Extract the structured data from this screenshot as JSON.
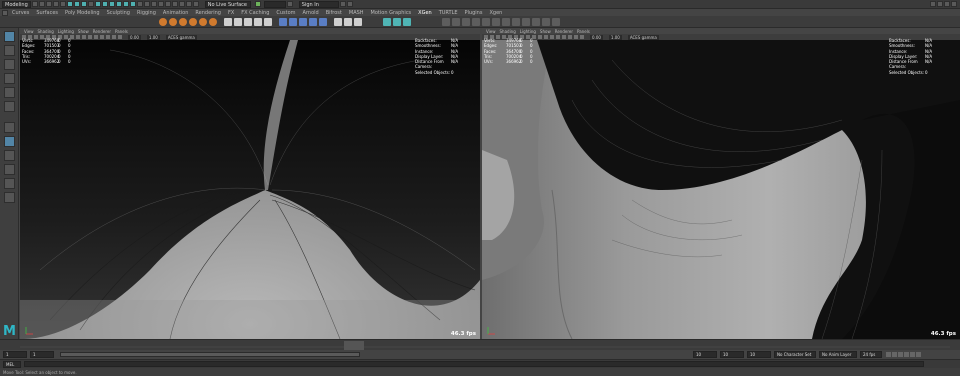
{
  "topbar": {
    "workspace": "Modeling",
    "surface_mode": "No Live Surface",
    "signin": "Sign In"
  },
  "shelf_tabs": [
    "Curves",
    "Surfaces",
    "Poly Modeling",
    "Sculpting",
    "Rigging",
    "Animation",
    "Rendering",
    "FX",
    "FX Caching",
    "Custom",
    "Arnold",
    "Bifrost",
    "MASH",
    "Motion Graphics",
    "XGen",
    "TURTLE",
    "Plugins",
    "Xgen"
  ],
  "shelf_active": "XGen",
  "viewport_menu": [
    "View",
    "Shading",
    "Lighting",
    "Show",
    "Renderer",
    "Panels"
  ],
  "left_viewport": {
    "camera_field": "0.00",
    "gamma_field": "1.00",
    "colorspace": "ACES gamma",
    "hud": [
      {
        "k": "Verts:",
        "v": "349768",
        "a": "0",
        "b": "0"
      },
      {
        "k": "Edges:",
        "v": "701503",
        "a": "0",
        "b": "0"
      },
      {
        "k": "Faces:",
        "v": "364700",
        "a": "0",
        "b": "0"
      },
      {
        "k": "Tris:",
        "v": "700204",
        "a": "0",
        "b": "0"
      },
      {
        "k": "UVs:",
        "v": "366962",
        "a": "0",
        "b": "0"
      }
    ],
    "hud_right": [
      {
        "k": "Backfaces:",
        "v": "N/A"
      },
      {
        "k": "Smoothness:",
        "v": "N/A"
      },
      {
        "k": "Instance:",
        "v": "N/A"
      },
      {
        "k": "Display Layer:",
        "v": "N/A"
      },
      {
        "k": "Distance From Camera:",
        "v": "N/A"
      },
      {
        "k": "Selected Objects:",
        "v": "0"
      }
    ],
    "fps": "46.3 fps"
  },
  "right_viewport": {
    "camera_field": "0.00",
    "gamma_field": "1.00",
    "colorspace": "ACES gamma",
    "hud": [
      {
        "k": "Verts:",
        "v": "349768",
        "a": "0",
        "b": "0"
      },
      {
        "k": "Edges:",
        "v": "701503",
        "a": "0",
        "b": "0"
      },
      {
        "k": "Faces:",
        "v": "364700",
        "a": "0",
        "b": "0"
      },
      {
        "k": "Tris:",
        "v": "700204",
        "a": "0",
        "b": "0"
      },
      {
        "k": "UVs:",
        "v": "366962",
        "a": "0",
        "b": "0"
      }
    ],
    "hud_right": [
      {
        "k": "Backfaces:",
        "v": "N/A"
      },
      {
        "k": "Smoothness:",
        "v": "N/A"
      },
      {
        "k": "Instance:",
        "v": "N/A"
      },
      {
        "k": "Display Layer:",
        "v": "N/A"
      },
      {
        "k": "Distance From Camera:",
        "v": "N/A"
      },
      {
        "k": "Selected Objects:",
        "v": "0"
      }
    ],
    "fps": "46.3 fps"
  },
  "timeline": {
    "start": "1",
    "current": "1",
    "range_start": "1",
    "range_end": "10",
    "end": "10",
    "end2": "10",
    "character_set": "No Character Set",
    "anim_layer": "No Anim Layer",
    "fps_setting": "24 fps"
  },
  "cmdline": {
    "lang": "MEL"
  },
  "helpline": {
    "text": "Move Tool: Select an object to move."
  }
}
